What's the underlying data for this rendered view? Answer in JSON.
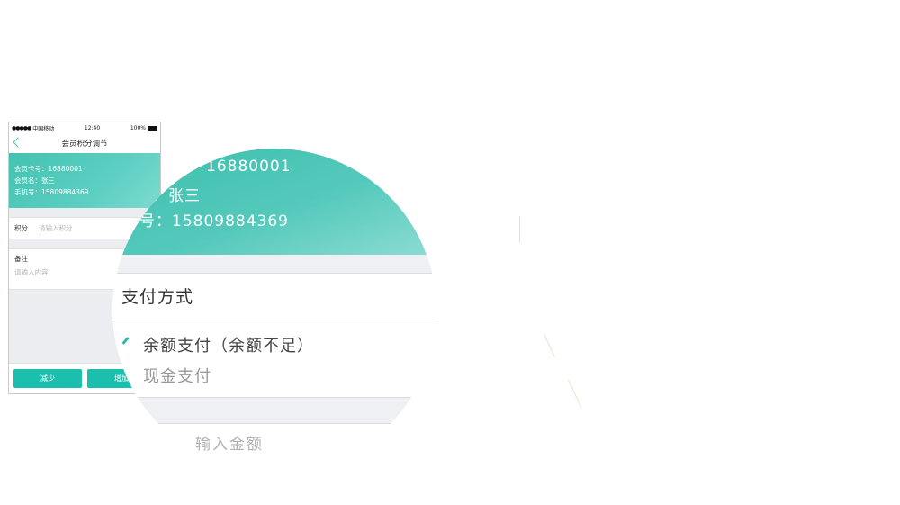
{
  "phone": {
    "status": {
      "carrier": "中国移动",
      "time": "12:40",
      "battery": "100%"
    },
    "nav": {
      "title": "会员积分调节"
    },
    "card": {
      "card_no": "会员卡号：16880001",
      "name": "会员名：张三",
      "phone": "手机号：15809884369"
    },
    "points": {
      "label": "积分",
      "placeholder": "请输入积分"
    },
    "notes": {
      "label": "备注",
      "placeholder": "请输入内容"
    },
    "buttons": {
      "decrease": "减少",
      "increase": "增加"
    }
  },
  "magnifier": {
    "card_no": "16880001",
    "name": "：张三",
    "phone": "号：15809884369",
    "pay_title": "支付方式",
    "option_balance": "余额支付（余额不足）",
    "option_cash": "现金支付",
    "amount": "输入金额"
  }
}
